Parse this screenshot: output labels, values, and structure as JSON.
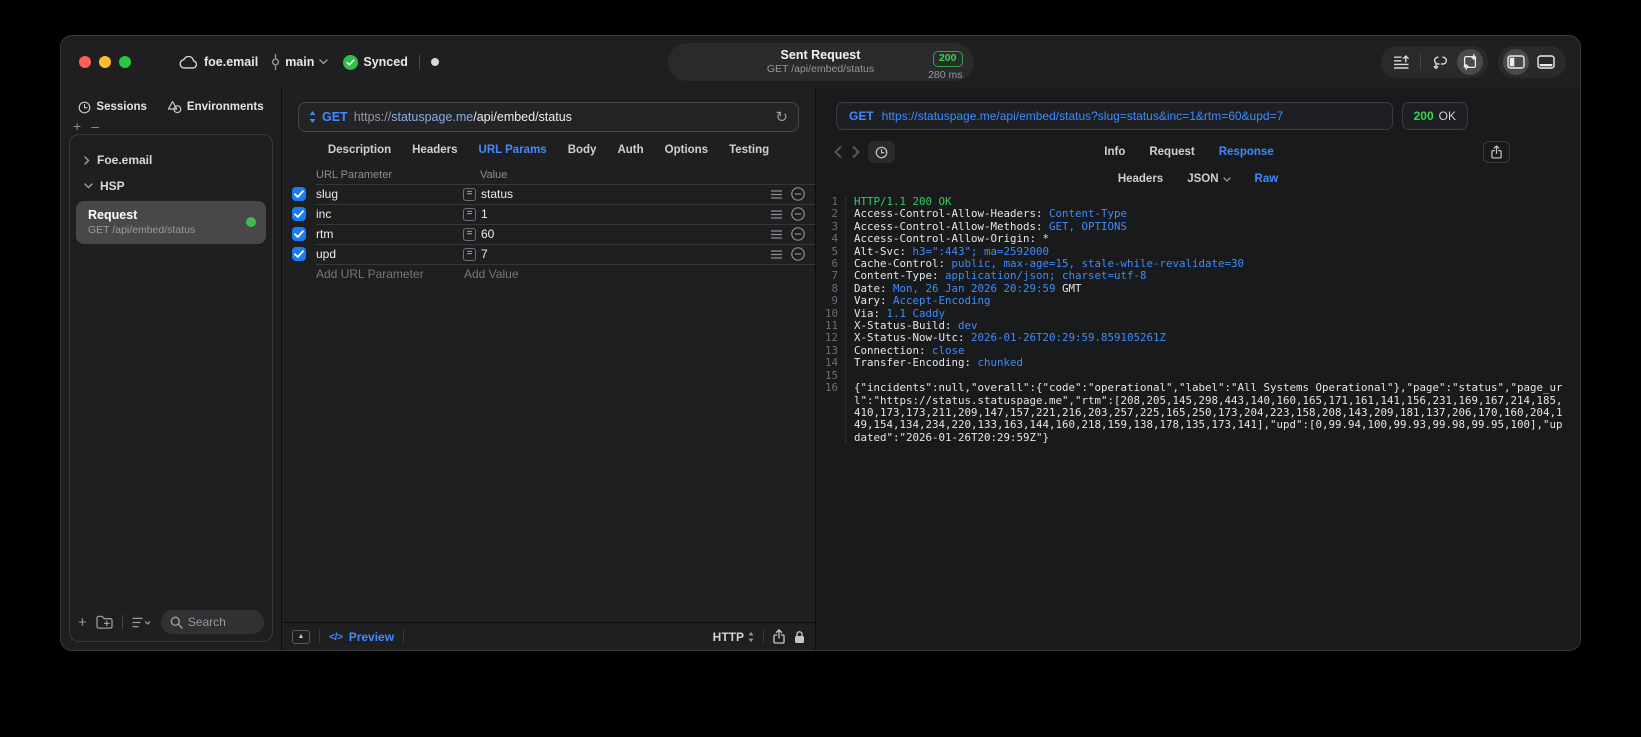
{
  "titlebar": {
    "project": "foe.email",
    "branch": "main",
    "sync": "Synced",
    "pill": {
      "title": "Sent Request",
      "subtitle": "GET /api/embed/status",
      "status": "200",
      "duration": "280 ms"
    }
  },
  "sidebar": {
    "tabs": [
      {
        "label": "Sessions"
      },
      {
        "label": "Environments"
      }
    ],
    "tree": [
      {
        "label": "Foe.email"
      },
      {
        "label": "HSP"
      }
    ],
    "request": {
      "name": "Request",
      "detail": "GET /api/embed/status"
    },
    "search_placeholder": "Search"
  },
  "request_pane": {
    "method": "GET",
    "url": {
      "scheme": "https://",
      "host": "statuspage.me",
      "path": "/api/embed/status"
    },
    "tabs": [
      "Description",
      "Headers",
      "URL Params",
      "Body",
      "Auth",
      "Options",
      "Testing"
    ],
    "active_tab": "URL Params",
    "table": {
      "columns": [
        "URL Parameter",
        "Value"
      ],
      "rows": [
        {
          "enabled": true,
          "name": "slug",
          "value": "status"
        },
        {
          "enabled": true,
          "name": "inc",
          "value": "1"
        },
        {
          "enabled": true,
          "name": "rtm",
          "value": "60"
        },
        {
          "enabled": true,
          "name": "upd",
          "value": "7"
        }
      ],
      "add_name": "Add URL Parameter",
      "add_value": "Add Value"
    },
    "footer": {
      "code_glyph": "</>",
      "preview": "Preview",
      "protocol": "HTTP"
    }
  },
  "response_pane": {
    "method": "GET",
    "url": "https://statuspage.me/api/embed/status?slug=status&inc=1&rtm=60&upd=7",
    "status_code": "200",
    "status_text": "OK",
    "tabs": [
      "Info",
      "Request",
      "Response"
    ],
    "active_tab": "Response",
    "subtabs": [
      "Headers",
      "JSON",
      "Raw"
    ],
    "active_subtab": "Raw",
    "code_lines": [
      {
        "n": "1",
        "parts": [
          {
            "t": "HTTP/1.1 200 OK",
            "c": "green"
          }
        ]
      },
      {
        "n": "2",
        "parts": [
          {
            "t": "Access-Control-Allow-Headers: ",
            "c": "fg"
          },
          {
            "t": "Content-Type",
            "c": "blue"
          }
        ]
      },
      {
        "n": "3",
        "parts": [
          {
            "t": "Access-Control-Allow-Methods: ",
            "c": "fg"
          },
          {
            "t": "GET, OPTIONS",
            "c": "blue"
          }
        ]
      },
      {
        "n": "4",
        "parts": [
          {
            "t": "Access-Control-Allow-Origin: ",
            "c": "fg"
          },
          {
            "t": "*",
            "c": "fg"
          }
        ]
      },
      {
        "n": "5",
        "parts": [
          {
            "t": "Alt-Svc: ",
            "c": "fg"
          },
          {
            "t": "h3=\":443\"; ma=2592000",
            "c": "blue"
          }
        ]
      },
      {
        "n": "6",
        "parts": [
          {
            "t": "Cache-Control: ",
            "c": "fg"
          },
          {
            "t": "public, max-age=15, stale-while-revalidate=30",
            "c": "blue"
          }
        ]
      },
      {
        "n": "7",
        "parts": [
          {
            "t": "Content-Type: ",
            "c": "fg"
          },
          {
            "t": "application/json; charset=utf-8",
            "c": "blue"
          }
        ]
      },
      {
        "n": "8",
        "parts": [
          {
            "t": "Date: ",
            "c": "fg"
          },
          {
            "t": "Mon, 26 Jan 2026 20:29:59",
            "c": "blue"
          },
          {
            "t": " GMT",
            "c": "fg"
          }
        ]
      },
      {
        "n": "9",
        "parts": [
          {
            "t": "Vary: ",
            "c": "fg"
          },
          {
            "t": "Accept-Encoding",
            "c": "blue"
          }
        ]
      },
      {
        "n": "10",
        "parts": [
          {
            "t": "Via: ",
            "c": "fg"
          },
          {
            "t": "1.1 Caddy",
            "c": "blue"
          }
        ]
      },
      {
        "n": "11",
        "parts": [
          {
            "t": "X-Status-Build: ",
            "c": "fg"
          },
          {
            "t": "dev",
            "c": "blue"
          }
        ]
      },
      {
        "n": "12",
        "parts": [
          {
            "t": "X-Status-Now-Utc: ",
            "c": "fg"
          },
          {
            "t": "2026-01-26T20:29:59.859105261Z",
            "c": "blue"
          }
        ]
      },
      {
        "n": "13",
        "parts": [
          {
            "t": "Connection: ",
            "c": "fg"
          },
          {
            "t": "close",
            "c": "blue"
          }
        ]
      },
      {
        "n": "14",
        "parts": [
          {
            "t": "Transfer-Encoding: ",
            "c": "fg"
          },
          {
            "t": "chunked",
            "c": "blue"
          }
        ]
      },
      {
        "n": "15",
        "parts": []
      },
      {
        "n": "16",
        "parts": [
          {
            "t": "{\"incidents\":null,\"overall\":{\"code\":\"operational\",\"label\":\"All Systems Operational\"},\"page\":\"status\",\"page_url\":\"https://status.statuspage.me\",\"rtm\":[208,205,145,298,443,140,160,165,171,161,141,156,231,169,167,214,185,410,173,173,211,209,147,157,221,216,203,257,225,165,250,173,204,223,158,208,143,209,181,137,206,170,160,204,149,154,134,234,220,133,163,144,160,218,159,138,178,135,173,141],\"upd\":[0,99.94,100,99.93,99.98,99.95,100],\"updated\":\"2026-01-26T20:29:59Z\"}",
            "c": "fg"
          }
        ]
      }
    ]
  },
  "colors": {
    "accent": "#3e8bff",
    "green": "#30d158",
    "checkbox_blue": "#1a7cf2",
    "status_green": "#32d74b"
  }
}
